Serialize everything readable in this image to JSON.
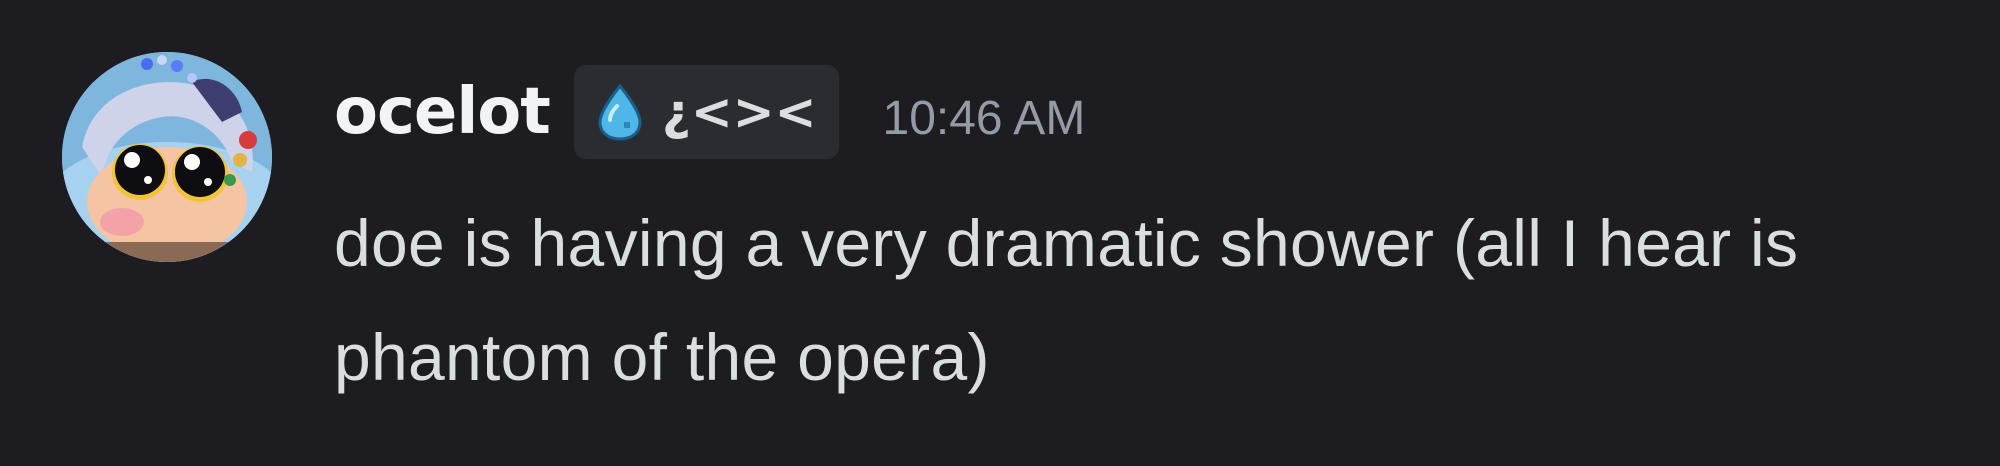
{
  "message": {
    "username": "ocelot",
    "tag": {
      "icon": "water-drop-icon",
      "text": "¿<><"
    },
    "timestamp": "10:46 AM",
    "content": "doe is having a very dramatic shower (all I hear is phantom of the opera)"
  },
  "colors": {
    "background": "#1c1c21",
    "username": "#f2f3f5",
    "content": "#dbdee1",
    "timestamp": "#949ba4",
    "tag_background": "#2b2c31",
    "tag_icon": "#4fb6e8"
  }
}
